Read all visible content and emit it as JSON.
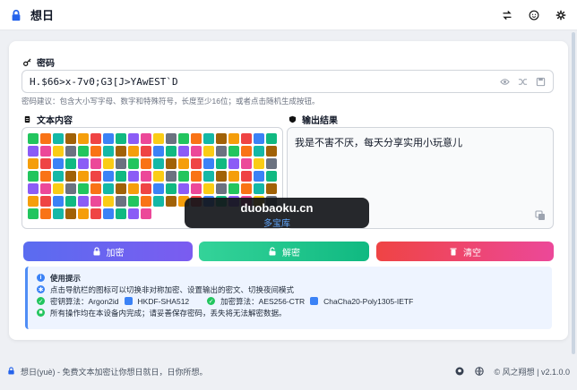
{
  "app": {
    "title": "想日"
  },
  "password": {
    "label": "密码",
    "value": "H.$66>x-7v0;G3[J>YAwEST`D",
    "hint": "密码建议：包含大小写字母、数字和特殊符号，长度至少16位；或者点击随机生成按钮。"
  },
  "input": {
    "label": "文本内容"
  },
  "output": {
    "label": "输出结果",
    "value": "我是不害不厌，每天分享实用小玩意儿"
  },
  "buttons": {
    "encrypt": "加密",
    "decrypt": "解密",
    "clear": "清空"
  },
  "tips": {
    "title": "使用提示",
    "line1": "点击导航栏的图标可以切换非对称加密、设置输出的密文、切换夜间模式",
    "kdf_label": "密钥算法：Argon2id",
    "kdf_extra": "HKDF-SHA512",
    "cipher_label": "加密算法：AES256-CTR",
    "cipher_extra": "ChaCha20-Poly1305-IETF",
    "line3": "所有操作均在本设备内完成；请妥善保存密码，丢失将无法解密数据。"
  },
  "footer": {
    "text": "想日(yuè) - 免费文本加密让你想日就日，日你所想。",
    "credit": "© 风之翔想 | v2.1.0.0"
  },
  "watermark": {
    "line1": "duobaoku.cn",
    "line2": "多宝库"
  },
  "colors": {
    "encrypt_grad": [
      "#5a6cf0",
      "#7b5cf0"
    ],
    "decrypt_grad": [
      "#34d399",
      "#10b981"
    ],
    "clear_grad": [
      "#ef4444",
      "#ec4899"
    ],
    "accent": "#3b82f6"
  },
  "icons": [
    "lock-icon",
    "swap-icon",
    "smile-icon",
    "gear-icon",
    "key-icon",
    "eye-icon",
    "shuffle-icon",
    "save-icon",
    "doc-icon",
    "shield-icon",
    "copy-icon",
    "info-icon",
    "github-icon",
    "globe-icon"
  ]
}
